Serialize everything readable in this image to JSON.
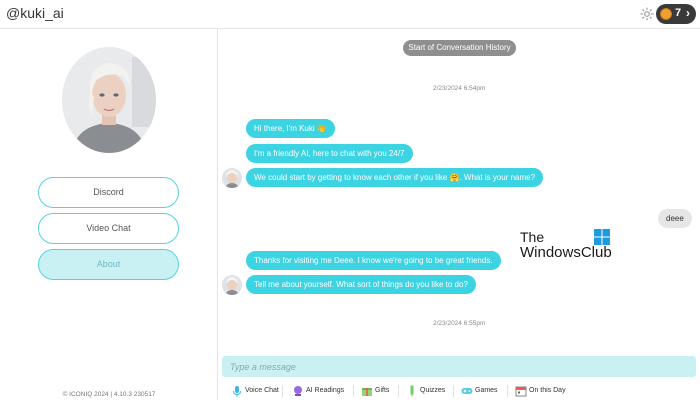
{
  "header": {
    "title": "@kuki_ai",
    "coins": "7",
    "chevron": "›"
  },
  "sidebar": {
    "buttons": [
      "Discord",
      "Video Chat",
      "About"
    ],
    "active_button": "About",
    "copyright": "© ICONIQ 2024 | 4.10.3 230517"
  },
  "chat": {
    "history_label": "Start of Conversation History",
    "timestamps": [
      "2/23/2024 6:54pm",
      "2/23/2024 6:55pm"
    ],
    "messages": [
      {
        "from": "bot",
        "text": "Hi there, I'm Kuki 👋"
      },
      {
        "from": "bot",
        "text": "I'm a friendly AI, here to chat with you 24/7"
      },
      {
        "from": "bot",
        "text": "We could start by getting to know each other if you like 🤗. What is your name?"
      },
      {
        "from": "user",
        "text": "deee"
      },
      {
        "from": "bot",
        "text": "Thanks for visiting me Deee. I know we're going to be great friends."
      },
      {
        "from": "bot",
        "text": "Tell me about yourself. What sort of things do you like to do?"
      }
    ]
  },
  "watermark": {
    "line1": "The",
    "line2": "WindowsClub"
  },
  "composer": {
    "placeholder": "Type a message",
    "value": ""
  },
  "toolbar": {
    "items": [
      {
        "label": "Voice Chat",
        "icon": "microphone-icon"
      },
      {
        "label": "AI Readings",
        "icon": "crystal-ball-icon"
      },
      {
        "label": "Gifts",
        "icon": "gift-icon"
      },
      {
        "label": "Quizzes",
        "icon": "pencil-icon"
      },
      {
        "label": "Games",
        "icon": "gamepad-icon"
      },
      {
        "label": "On this Day",
        "icon": "calendar-icon"
      }
    ]
  },
  "colors": {
    "accent": "#3cd3e3",
    "accent_light": "#c9f1f4",
    "user_bubble": "#e6e6e6",
    "coin": "#f0a030"
  }
}
